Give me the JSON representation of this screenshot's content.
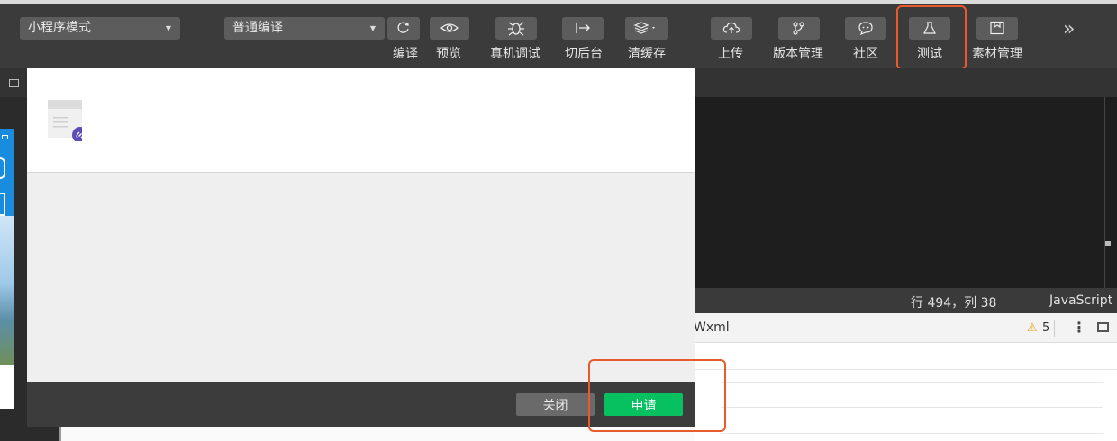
{
  "toolbar": {
    "mode_select": "小程序模式",
    "compile_select": "普通编译",
    "buttons": {
      "compile": "编译",
      "preview": "预览",
      "remote_debug": "真机调试",
      "background": "切后台",
      "clear_cache": "清缓存",
      "upload": "上传",
      "version": "版本管理",
      "community": "社区",
      "test": "测试",
      "assets": "素材管理"
    },
    "more": "»"
  },
  "editor": {
    "cursor_position": "行 494，列 38",
    "language": "JavaScript"
  },
  "debugger": {
    "tab": "Wxml",
    "warning_count": "5"
  },
  "modal": {
    "close_label": "关闭",
    "apply_label": "申请"
  },
  "colors": {
    "accent_green": "#07c160",
    "highlight_orange": "#e95a2c",
    "toolbar_bg": "#3b3b3b"
  }
}
